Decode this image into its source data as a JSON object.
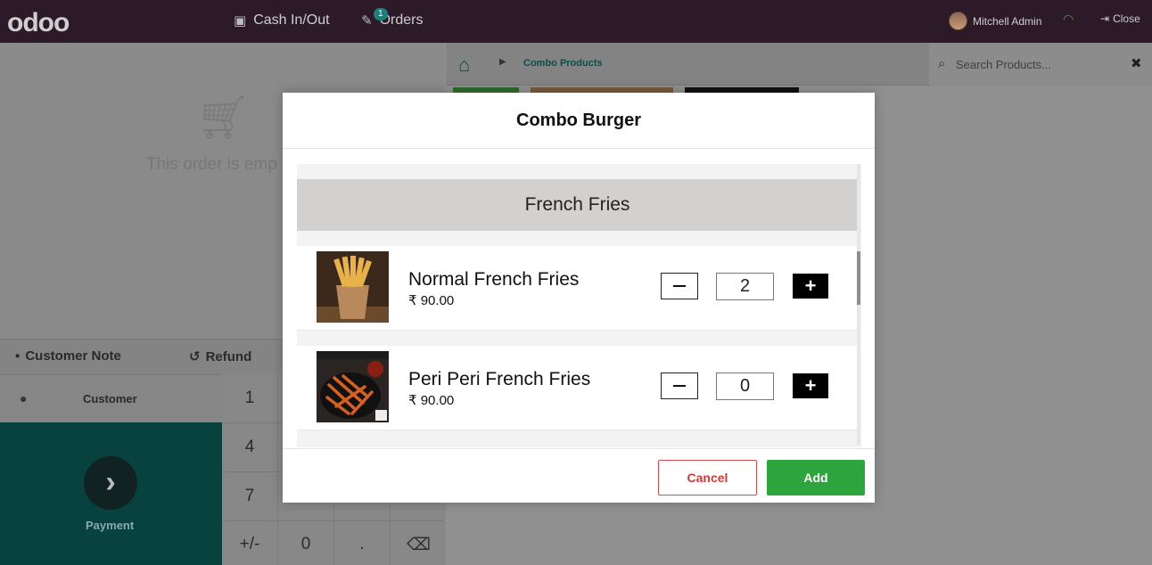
{
  "navbar": {
    "logo": "odoo",
    "cash_label": "Cash In/Out",
    "orders_label": "Orders",
    "orders_badge": "1",
    "user_name": "Mitchell Admin",
    "close_label": "Close"
  },
  "order": {
    "empty_text": "This order is emp",
    "customer_note_label": "Customer Note",
    "refund_label": "Refund",
    "customer_label": "Customer",
    "payment_label": "Payment"
  },
  "numpad": {
    "keys": [
      "1",
      "",
      "",
      "",
      "4",
      "",
      "",
      "",
      "7",
      "",
      "",
      "",
      "+/-",
      "0",
      ".",
      "⌫"
    ]
  },
  "products": {
    "breadcrumb_category": "Combo Products",
    "search_placeholder": "Search Products..."
  },
  "modal": {
    "title": "Combo Burger",
    "category": "French Fries",
    "items": [
      {
        "name": "Normal French Fries",
        "price": "₹ 90.00",
        "qty": "2"
      },
      {
        "name": "Peri Peri French Fries",
        "price": "₹ 90.00",
        "qty": "0"
      }
    ],
    "cancel_label": "Cancel",
    "add_label": "Add"
  },
  "colors": {
    "navbar": "#2d1a29",
    "payment": "#08423f",
    "add_button": "#2ea43d",
    "cancel_border": "#d94b4b"
  }
}
